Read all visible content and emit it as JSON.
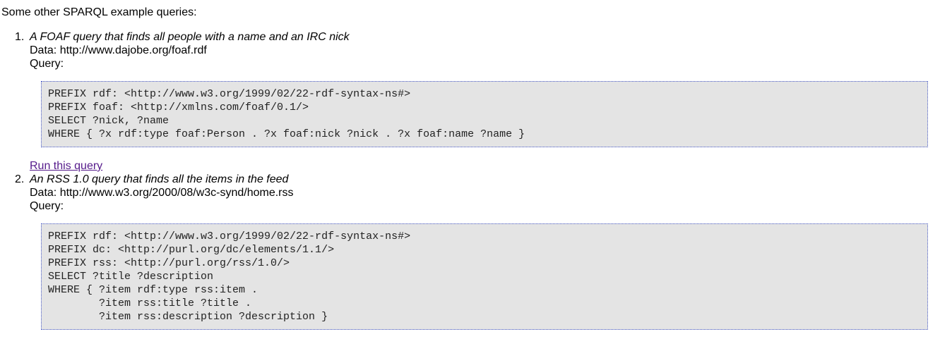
{
  "intro": "Some other SPARQL example queries:",
  "examples": [
    {
      "number": "1.",
      "title": "A FOAF query that finds all people with a name and an IRC nick",
      "data_line": "Data: http://www.dajobe.org/foaf.rdf",
      "query_label": "Query:",
      "code": "PREFIX rdf: <http://www.w3.org/1999/02/22-rdf-syntax-ns#>\nPREFIX foaf: <http://xmlns.com/foaf/0.1/>\nSELECT ?nick, ?name\nWHERE { ?x rdf:type foaf:Person . ?x foaf:nick ?nick . ?x foaf:name ?name }",
      "run_link": "Run this query"
    },
    {
      "number": "2.",
      "title": "An RSS 1.0 query that finds all the items in the feed",
      "data_line": "Data: http://www.w3.org/2000/08/w3c-synd/home.rss",
      "query_label": "Query:",
      "code": "PREFIX rdf: <http://www.w3.org/1999/02/22-rdf-syntax-ns#>\nPREFIX dc: <http://purl.org/dc/elements/1.1/>\nPREFIX rss: <http://purl.org/rss/1.0/>\nSELECT ?title ?description\nWHERE { ?item rdf:type rss:item .\n        ?item rss:title ?title .\n        ?item rss:description ?description }"
    }
  ],
  "colors": {
    "code_background": "#e4e4e4",
    "code_border": "#4a5cc9",
    "visited_link": "#551a8b"
  }
}
